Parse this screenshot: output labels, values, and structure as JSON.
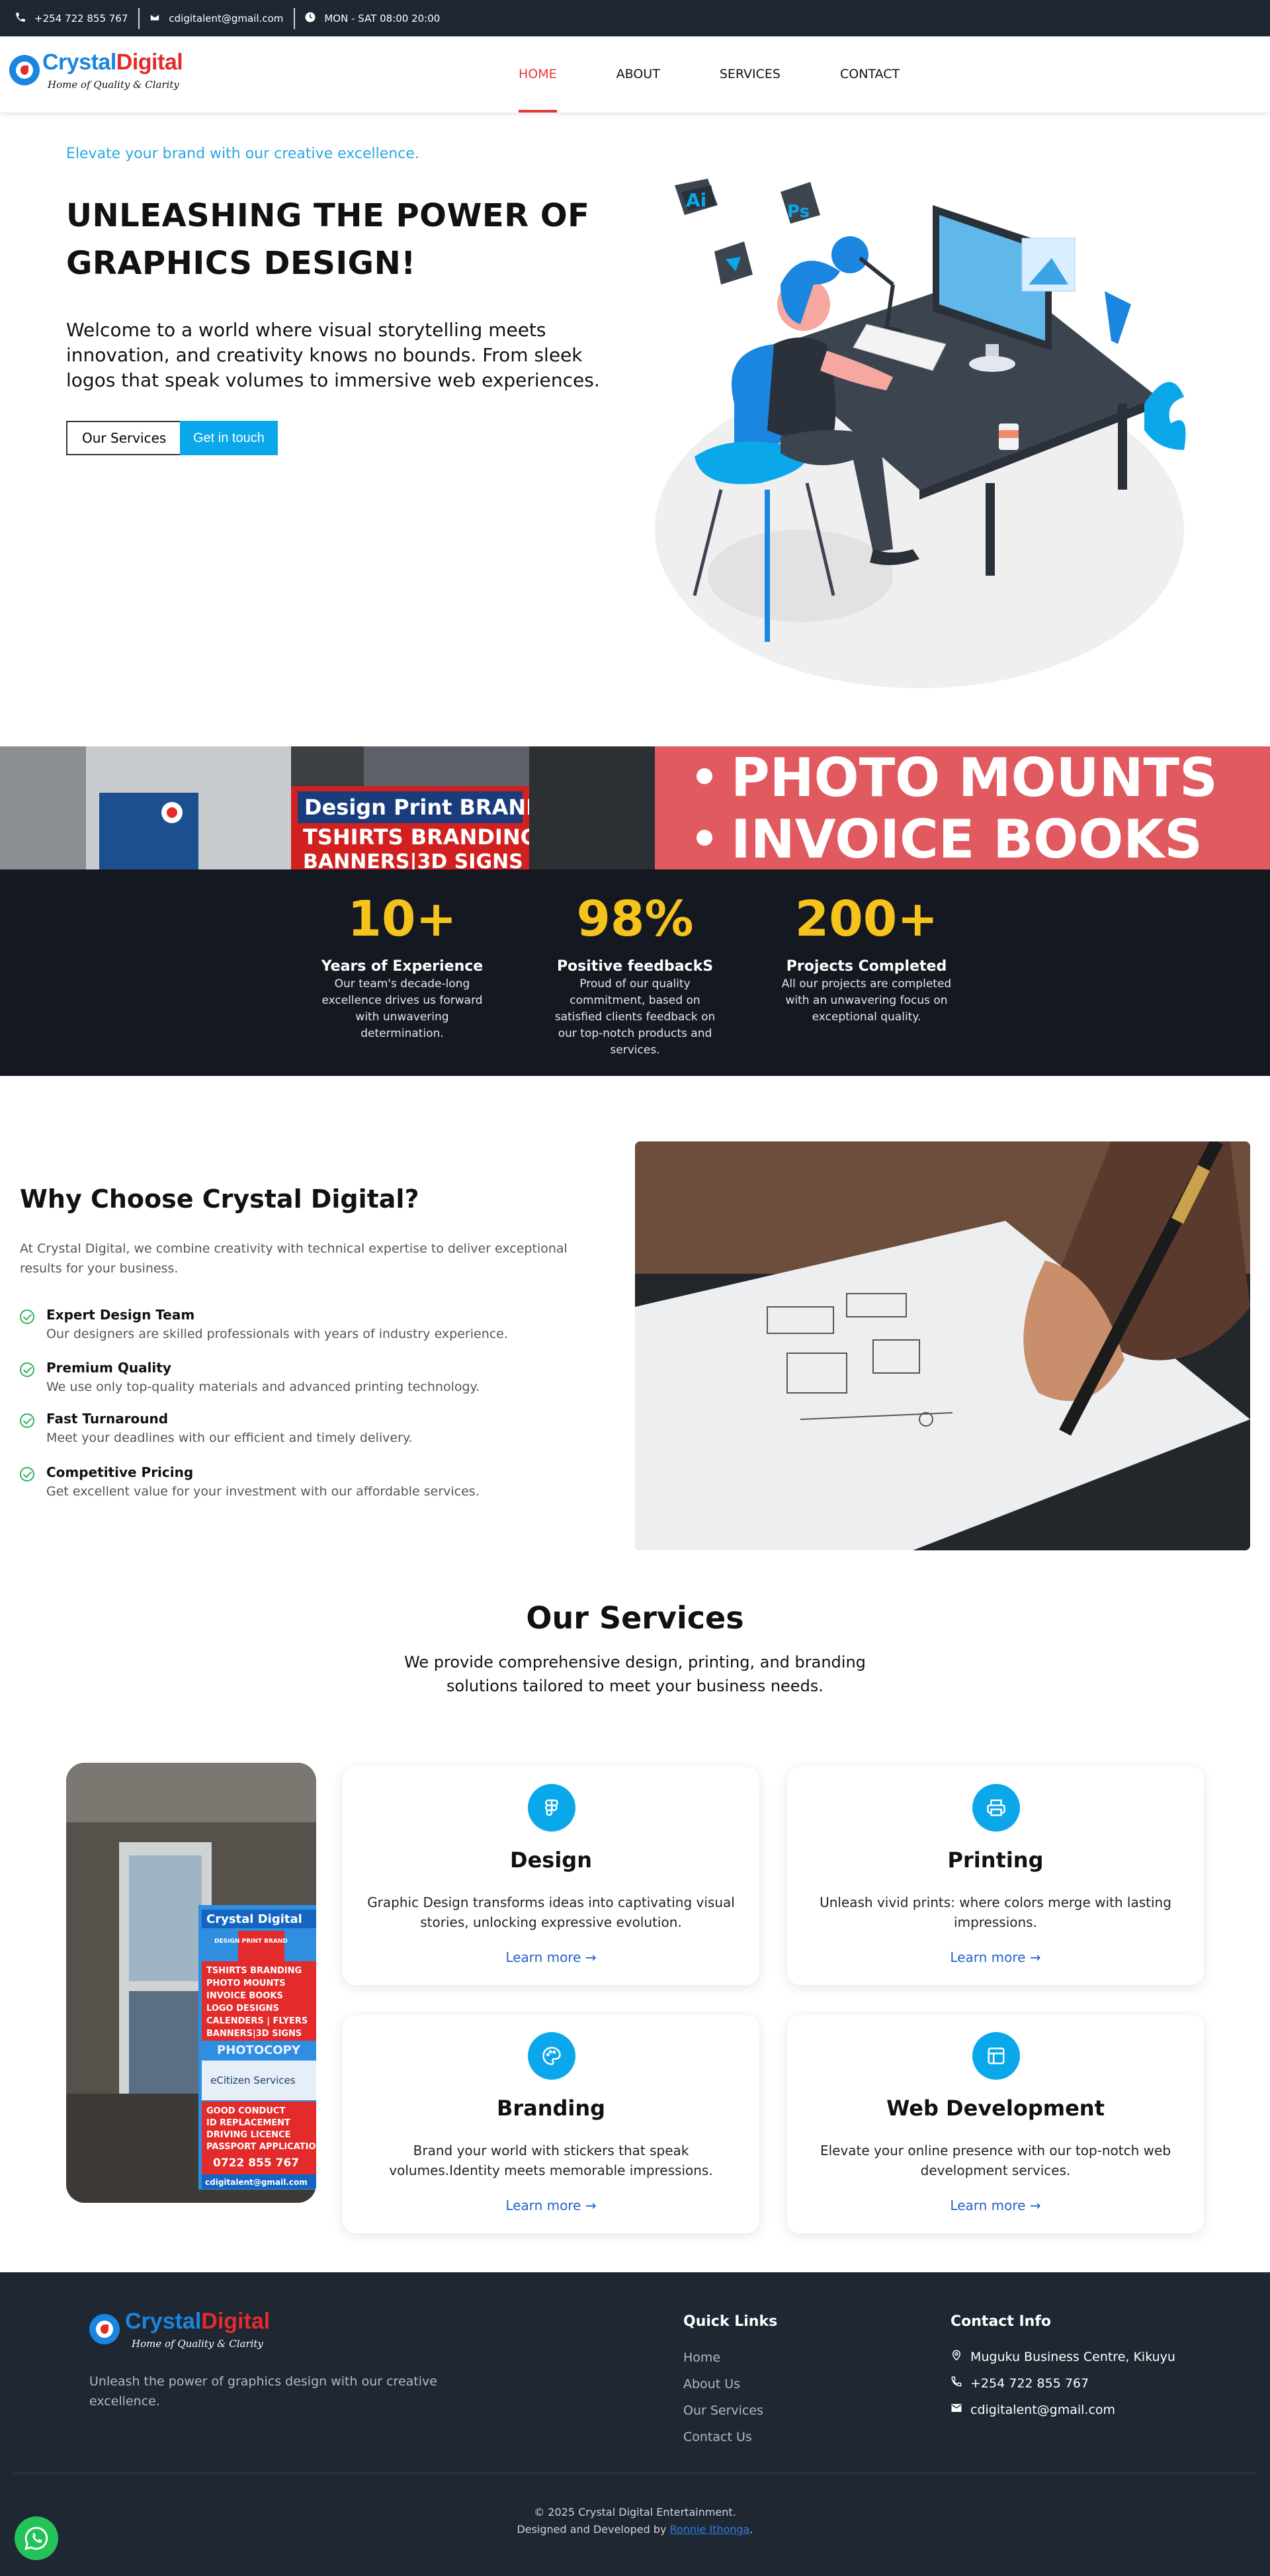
{
  "topbar": {
    "phone": "+254 722 855 767",
    "email": "cdigitalent@gmail.com",
    "hours": "MON - SAT 08:00 20:00"
  },
  "brand": {
    "name_part1": "Crystal",
    "name_part2": "Digital",
    "tagline": "Home of Quality & Clarity"
  },
  "nav": {
    "items": [
      {
        "label": "HOME",
        "active": true
      },
      {
        "label": "ABOUT",
        "active": false
      },
      {
        "label": "SERVICES",
        "active": false
      },
      {
        "label": "CONTACT",
        "active": false
      }
    ]
  },
  "hero": {
    "kicker": "Elevate your brand with our creative excellence.",
    "title": "UNLEASHING THE POWER OF GRAPHICS DESIGN!",
    "text": "Welcome to a world where visual storytelling meets innovation, and creativity knows no bounds. From sleek logos that speak volumes to immersive web experiences.",
    "btn_services": "Our Services",
    "btn_contact": "Get in touch",
    "illus_labels": {
      "ai": "Ai",
      "ps": "Ps"
    }
  },
  "banner": {
    "sign1": "Design Print BRAND",
    "sign2": "TSHIRTS BRANDING",
    "sign3": "BANNERS|3D SIGNS",
    "line1": "PHOTO MOUNTS",
    "line2": "INVOICE BOOKS"
  },
  "stats": [
    {
      "num": "10+",
      "label": "Years of Experience",
      "desc": "Our team's decade-long excellence drives us forward with unwavering determination."
    },
    {
      "num": "98%",
      "label": "Positive feedbackS",
      "desc": "Proud of our quality commitment, based on satisfied clients feedback on our top-notch products and services."
    },
    {
      "num": "200+",
      "label": "Projects Completed",
      "desc": "All our projects are completed with an unwavering focus on exceptional quality."
    }
  ],
  "why": {
    "title": "Why Choose Crystal Digital?",
    "intro": "At Crystal Digital, we combine creativity with technical expertise to deliver exceptional results for your business.",
    "items": [
      {
        "title": "Expert Design Team",
        "desc": "Our designers are skilled professionals with years of industry experience."
      },
      {
        "title": "Premium Quality",
        "desc": "We use only top-quality materials and advanced printing technology."
      },
      {
        "title": "Fast Turnaround",
        "desc": "Meet your deadlines with our efficient and timely delivery."
      },
      {
        "title": "Competitive Pricing",
        "desc": "Get excellent value for your investment with our affordable services."
      }
    ]
  },
  "services": {
    "title": "Our Services",
    "subtitle": "We provide comprehensive design, printing, and branding solutions tailored to meet your business needs.",
    "cards": [
      {
        "title": "Design",
        "desc": "Graphic Design transforms ideas into captivating visual stories, unlocking expressive evolution.",
        "link": "Learn more",
        "icon": "figma-icon"
      },
      {
        "title": "Printing",
        "desc": "Unleash vivid prints: where colors merge with lasting impressions.",
        "link": "Learn more",
        "icon": "printer-icon"
      },
      {
        "title": "Branding",
        "desc": "Brand your world with stickers that speak volumes.Identity meets memorable impressions.",
        "link": "Learn more",
        "icon": "palette-icon"
      },
      {
        "title": "Web Development",
        "desc": "Elevate your online presence with our top-notch web development services.",
        "link": "Learn more",
        "icon": "layout-icon"
      }
    ],
    "photo_sign": {
      "brand": "Crystal Digital",
      "tag": "DESIGN PRINT BRAND",
      "lines": [
        "TSHIRTS BRANDING",
        "PHOTO MOUNTS",
        "INVOICE BOOKS",
        "LOGO DESIGNS",
        "CALENDERS | FLYERS",
        "BANNERS|3D SIGNS"
      ],
      "mid": "PHOTOCOPY",
      "citizen": "eCitizen Services",
      "lines2": [
        "GOOD CONDUCT",
        "ID REPLACEMENT",
        "DRIVING LICENCE",
        "PASSPORT APPLICATION"
      ],
      "phone": "0722 855 767",
      "email": "cdigitalent@gmail.com"
    }
  },
  "footer": {
    "about": "Unleash the power of graphics design with our creative excellence.",
    "quick_title": "Quick Links",
    "links": [
      "Home",
      "About Us",
      "Our Services",
      "Contact Us"
    ],
    "contact_title": "Contact Info",
    "address": "Muguku Business Centre, Kikuyu",
    "phone": "+254 722 855 767",
    "email": "cdigitalent@gmail.com",
    "copyright": "© 2025 Crystal Digital Entertainment.",
    "designed_by": "Designed and Developed by",
    "author": "Ronnie Ithonga",
    "period": "."
  },
  "colors": {
    "accent": "#0aa7ea",
    "nav_active": "#e53935",
    "stat_number": "#f6c21c",
    "dark_bg": "#1f2733",
    "check_green": "#2eb35a",
    "link_blue": "#1e63c8",
    "whatsapp": "#25c25a"
  }
}
